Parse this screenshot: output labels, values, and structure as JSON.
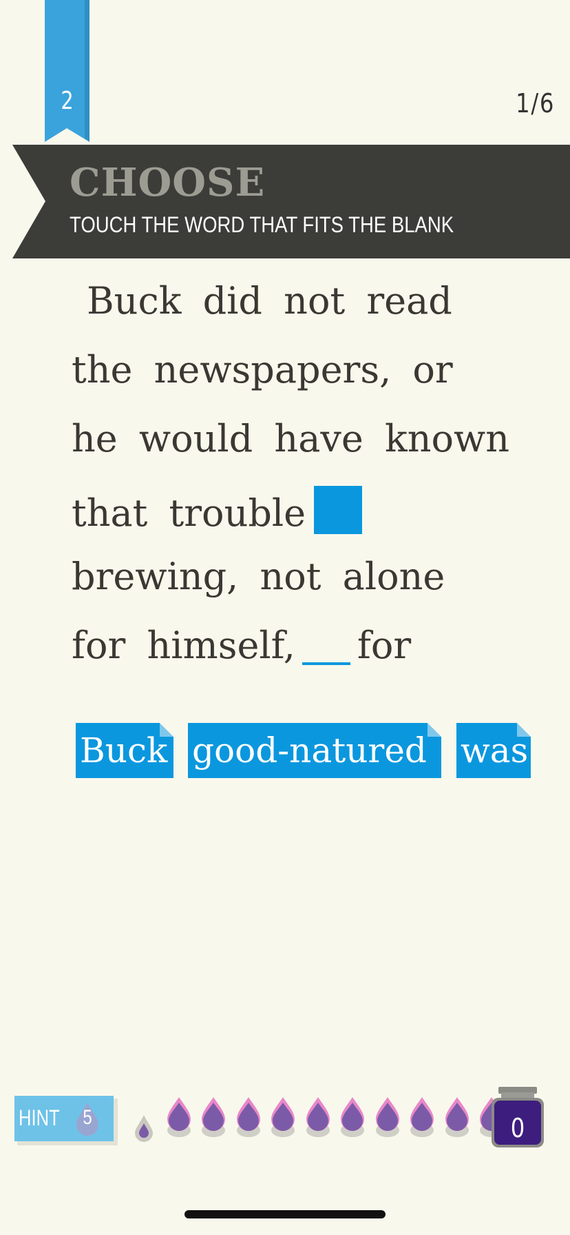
{
  "level": {
    "number": "2"
  },
  "progress": {
    "text": "1/6"
  },
  "banner": {
    "title": "CHOOSE",
    "subtitle": "TOUCH THE WORD THAT FITS THE BLANK"
  },
  "passage": {
    "lines": [
      "Buck did not read",
      "the newspapers, or",
      "he would have known",
      "that trouble",
      "brewing, not alone",
      "for himself,",
      "for"
    ]
  },
  "choices": [
    "Buck",
    "good-natured",
    "was"
  ],
  "hint": {
    "label": "HINT",
    "count": "5"
  },
  "ink": {
    "count": "0",
    "drops_filled": 10,
    "drops_total": 11
  },
  "colors": {
    "accent_blue": "#0b97de",
    "banner_dark": "#3c3c39",
    "ink_purple": "#7b5ba8",
    "inkwell": "#3d1d7e"
  }
}
